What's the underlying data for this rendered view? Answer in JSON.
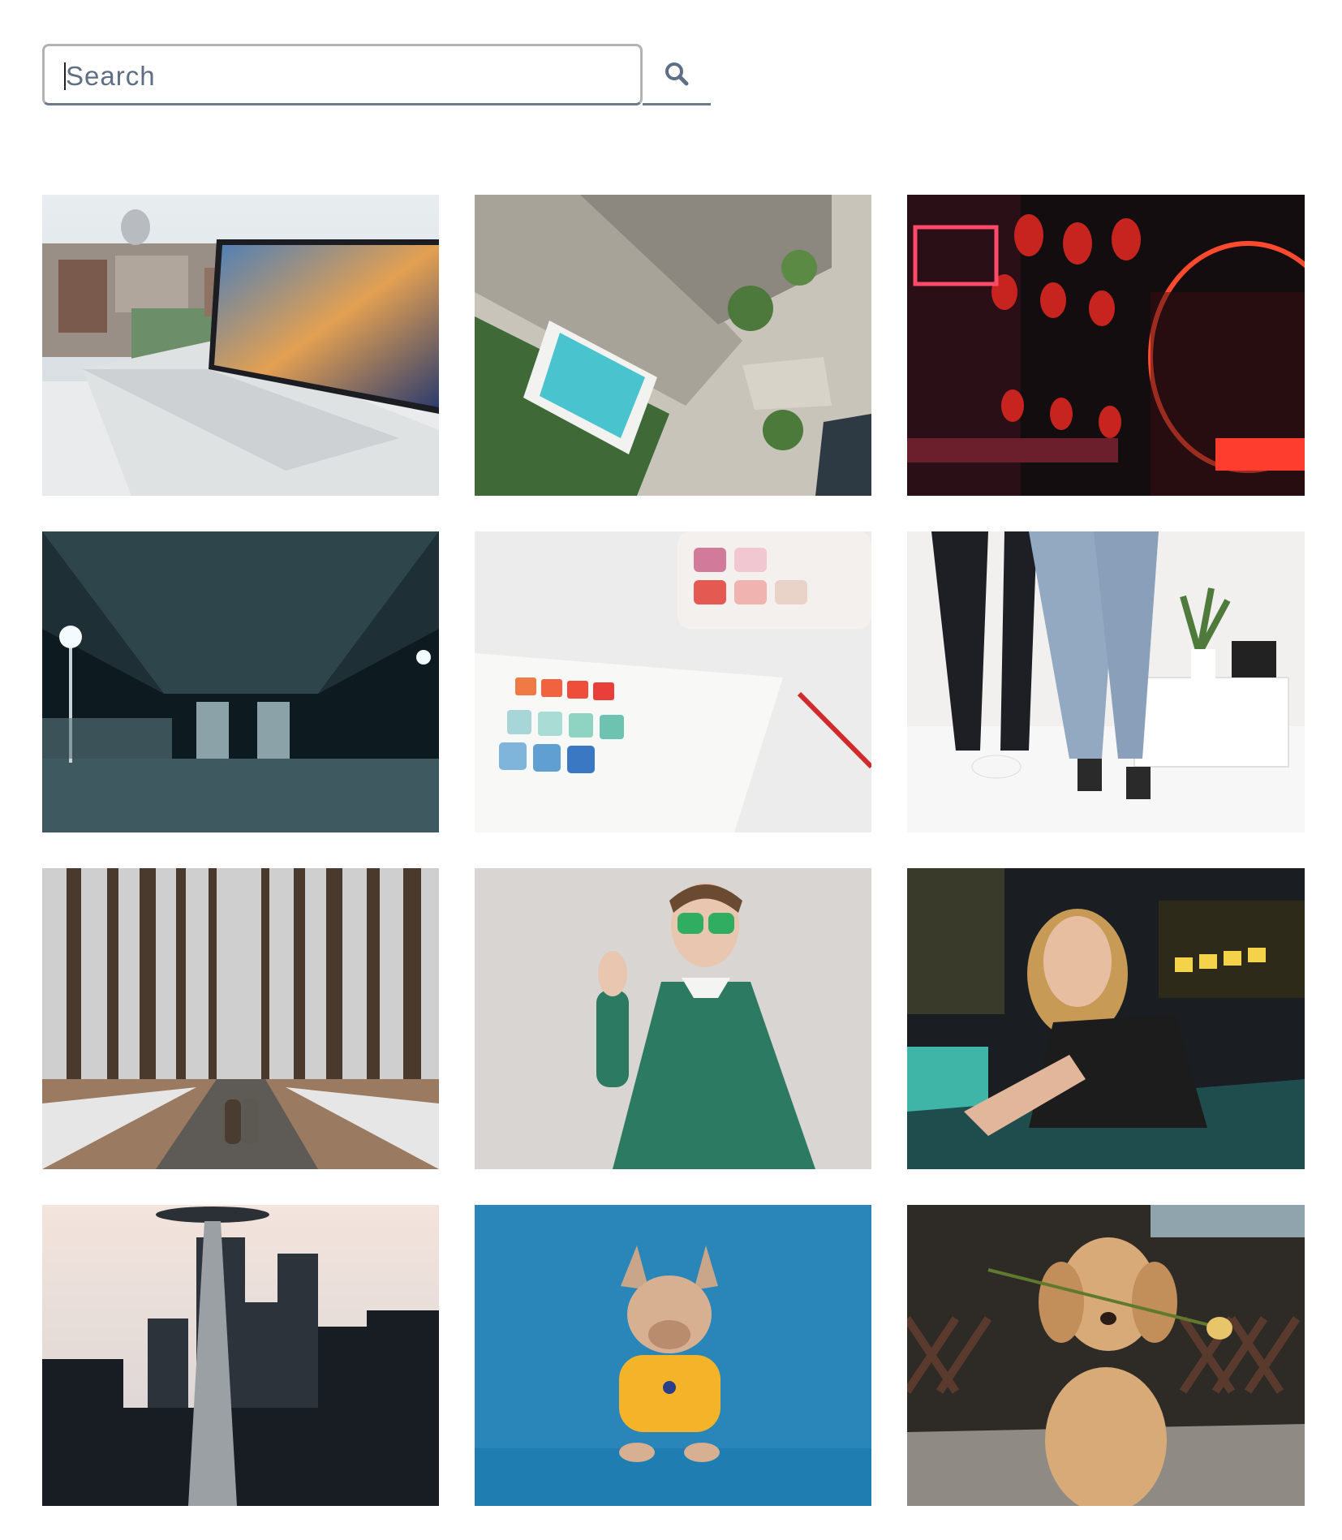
{
  "search": {
    "placeholder": "Search",
    "value": "",
    "button_icon": "search-icon",
    "border_color": "#6b7a8c"
  },
  "gallery": {
    "items": [
      {
        "name": "photo-laptop-city",
        "subject": "laptop-on-table"
      },
      {
        "name": "photo-aerial-pool",
        "subject": "aerial-pool"
      },
      {
        "name": "photo-neon-lanterns",
        "subject": "neon-street"
      },
      {
        "name": "photo-highway-underpass",
        "subject": "underpass"
      },
      {
        "name": "photo-watercolor-palette",
        "subject": "watercolor"
      },
      {
        "name": "photo-bed-jumping",
        "subject": "bedroom-legs"
      },
      {
        "name": "photo-winter-forest-couple",
        "subject": "forest-path"
      },
      {
        "name": "photo-man-green-sweater",
        "subject": "green-sweater"
      },
      {
        "name": "photo-arcade-woman",
        "subject": "arcade"
      },
      {
        "name": "photo-space-needle",
        "subject": "space-needle"
      },
      {
        "name": "photo-bulldog-yellow",
        "subject": "bulldog"
      },
      {
        "name": "photo-golden-retriever-rose",
        "subject": "retriever"
      }
    ]
  }
}
